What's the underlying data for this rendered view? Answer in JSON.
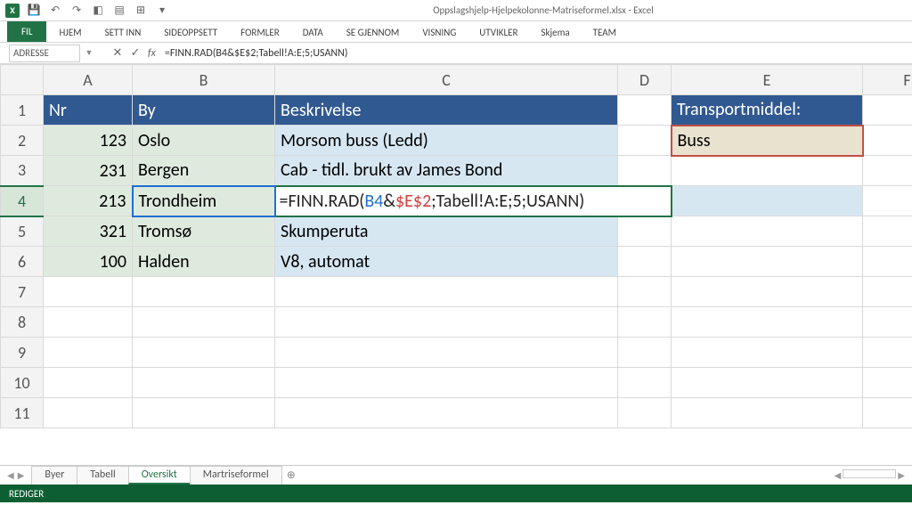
{
  "app": {
    "title": "Oppslagshjelp-Hjelpekolonne-Matriseformel.xlsx - Excel"
  },
  "qat": {
    "logo": "X"
  },
  "ribbon": {
    "file": "FIL",
    "tabs": [
      "HJEM",
      "SETT INN",
      "SIDEOPPSETT",
      "FORMLER",
      "DATA",
      "SE GJENNOM",
      "VISNING",
      "UTVIKLER",
      "Skjema",
      "TEAM"
    ]
  },
  "formula_bar": {
    "name_box": "ADRESSE",
    "cancel": "✕",
    "enter": "✓",
    "fx": "fx",
    "formula": "=FINN.RAD(B4&$E$2;Tabell!A:E;5;USANN)"
  },
  "columns": [
    "A",
    "B",
    "C",
    "D",
    "E",
    "F"
  ],
  "row_numbers": [
    "1",
    "2",
    "3",
    "4",
    "5",
    "6",
    "7",
    "8",
    "9",
    "10",
    "11"
  ],
  "table": {
    "headers": {
      "nr": "Nr",
      "by": "By",
      "beskrivelse": "Beskrivelse"
    },
    "rows": [
      {
        "nr": "123",
        "by": "Oslo",
        "beskrivelse": "Morsom buss (Ledd)"
      },
      {
        "nr": "231",
        "by": "Bergen",
        "beskrivelse": "Cab - tidl. brukt av James Bond"
      },
      {
        "nr": "213",
        "by": "Trondheim",
        "beskrivelse": ""
      },
      {
        "nr": "321",
        "by": "Tromsø",
        "beskrivelse": "Skumperuta"
      },
      {
        "nr": "100",
        "by": "Halden",
        "beskrivelse": "V8, automat"
      }
    ]
  },
  "editing_formula": {
    "prefix": "=FINN.RAD(",
    "ref1": "B4",
    "amp": "&",
    "ref2": "$E$2",
    "suffix": ";Tabell!A:E;5;USANN)"
  },
  "side": {
    "label": "Transportmiddel:",
    "value": "Buss"
  },
  "sheets": {
    "tabs": [
      "Byer",
      "Tabell",
      "Oversikt",
      "Martriseformel"
    ],
    "active": "Oversikt",
    "add": "⊕"
  },
  "status": {
    "mode": "REDIGER"
  }
}
